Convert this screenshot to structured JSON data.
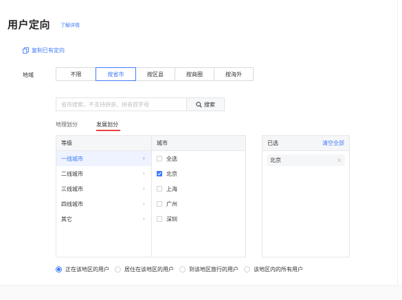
{
  "header": {
    "title": "用户定向",
    "detail_link": "了解详情"
  },
  "copy_existing": {
    "label": "复制已有定向",
    "icon": "copy-icon"
  },
  "region": {
    "label": "地域",
    "options": [
      "不限",
      "按省市",
      "按区县",
      "按商圈",
      "按海外"
    ],
    "selected": "按省市"
  },
  "search": {
    "placeholder": "省市搜索，不支持拼音、拼音首字母",
    "value": "",
    "button_label": "搜索",
    "icon": "search-icon"
  },
  "sub_tabs": [
    {
      "label": "地理划分",
      "active": false
    },
    {
      "label": "发展划分",
      "active": true
    }
  ],
  "tier_column": {
    "header": "等级",
    "items": [
      {
        "label": "一线城市",
        "active": true
      },
      {
        "label": "二线城市",
        "active": false
      },
      {
        "label": "三线城市",
        "active": false
      },
      {
        "label": "四线城市",
        "active": false
      },
      {
        "label": "其它",
        "active": false
      }
    ]
  },
  "city_column": {
    "header": "城市",
    "items": [
      {
        "label": "全选",
        "checked": false
      },
      {
        "label": "北京",
        "checked": true
      },
      {
        "label": "上海",
        "checked": false
      },
      {
        "label": "广州",
        "checked": false
      },
      {
        "label": "深圳",
        "checked": false
      }
    ]
  },
  "selected_panel": {
    "header": "已选",
    "clear_all": "清空全部",
    "items": [
      "北京"
    ]
  },
  "user_scope": {
    "options": [
      "正在该地区的用户",
      "居住在该地区的用户",
      "到该地区旅行的用户",
      "该地区内的所有用户"
    ],
    "selected_index": 0
  },
  "colors": {
    "accent": "#3e7bfa",
    "tab_underline": "#e8424a",
    "border": "#e6e6e6",
    "header_bg": "#f5f6f8"
  }
}
